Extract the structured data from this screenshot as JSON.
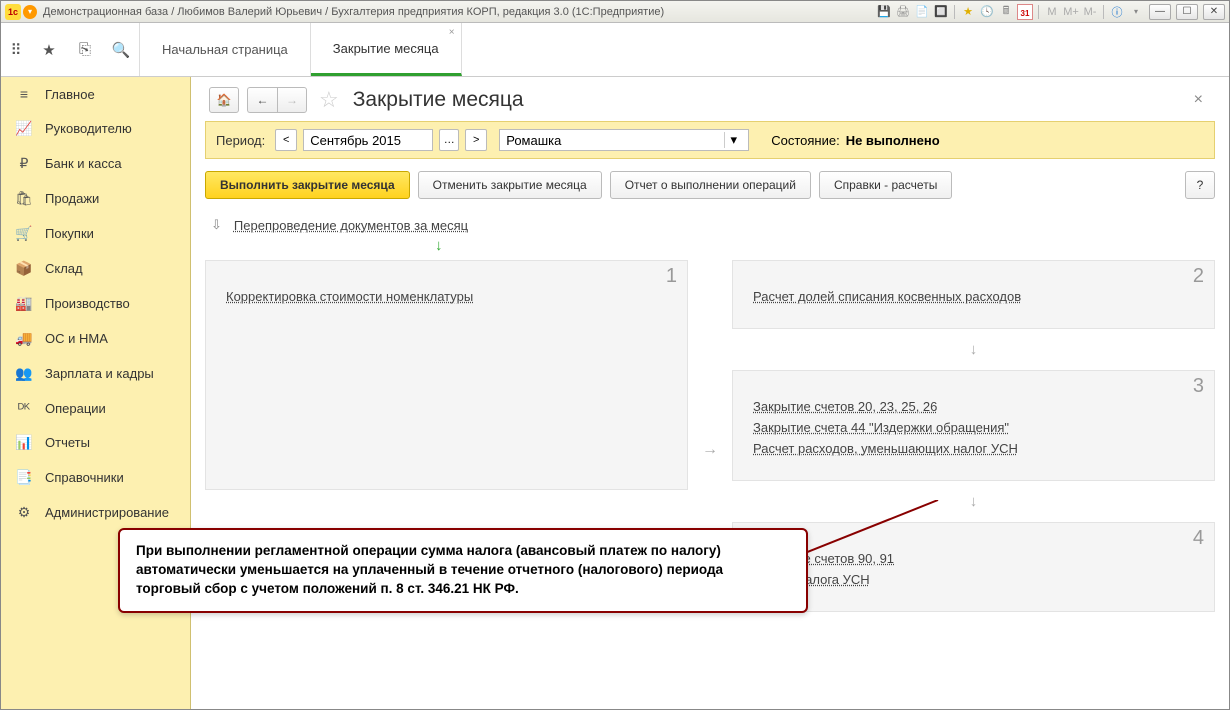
{
  "titlebar": {
    "text": "Демонстрационная база / Любимов Валерий Юрьевич / Бухгалтерия предприятия КОРП, редакция 3.0  (1С:Предприятие)",
    "m": "M",
    "mplus": "M+",
    "mminus": "M-",
    "cal": "31"
  },
  "tabs": {
    "start": "Начальная страница",
    "active": "Закрытие месяца"
  },
  "sidebar": {
    "items": [
      {
        "icon": "≡",
        "label": "Главное"
      },
      {
        "icon": "📈",
        "label": "Руководителю"
      },
      {
        "icon": "₽",
        "label": "Банк и касса"
      },
      {
        "icon": "🛍",
        "label": "Продажи"
      },
      {
        "icon": "🛒",
        "label": "Покупки"
      },
      {
        "icon": "📦",
        "label": "Склад"
      },
      {
        "icon": "🏭",
        "label": "Производство"
      },
      {
        "icon": "🚚",
        "label": "ОС и НМА"
      },
      {
        "icon": "👥",
        "label": "Зарплата и кадры"
      },
      {
        "icon": "ᴰᴷ",
        "label": "Операции"
      },
      {
        "icon": "📊",
        "label": "Отчеты"
      },
      {
        "icon": "📑",
        "label": "Справочники"
      },
      {
        "icon": "⚙",
        "label": "Администрирование"
      }
    ]
  },
  "page": {
    "title": "Закрытие месяца",
    "period_label": "Период:",
    "period_value": "Сентябрь 2015",
    "org_value": "Ромашка",
    "status_label": "Состояние:",
    "status_value": "Не выполнено"
  },
  "buttons": {
    "execute": "Выполнить закрытие месяца",
    "cancel": "Отменить закрытие месяца",
    "report": "Отчет о выполнении операций",
    "refs": "Справки - расчеты",
    "help": "?"
  },
  "ops": {
    "repost": "Перепроведение документов за месяц",
    "block1": {
      "num": "1",
      "link1": "Корректировка стоимости номенклатуры"
    },
    "block2": {
      "num": "2",
      "link1": "Расчет долей списания косвенных расходов"
    },
    "block3": {
      "num": "3",
      "link1": "Закрытие счетов 20, 23, 25, 26",
      "link2": "Закрытие счета 44 \"Издержки обращения\"",
      "link3": "Расчет расходов, уменьшающих налог УСН"
    },
    "block4": {
      "num": "4",
      "link1": "Закрытие счетов 90, 91",
      "link2": "Расчет налога УСН"
    }
  },
  "callout": "При выполнении регламентной операции сумма налога (авансовый платеж по налогу) автоматически уменьшается на уплаченный в течение отчетного (налогового) периода торговый сбор с учетом положений п. 8 ст. 346.21 НК РФ."
}
